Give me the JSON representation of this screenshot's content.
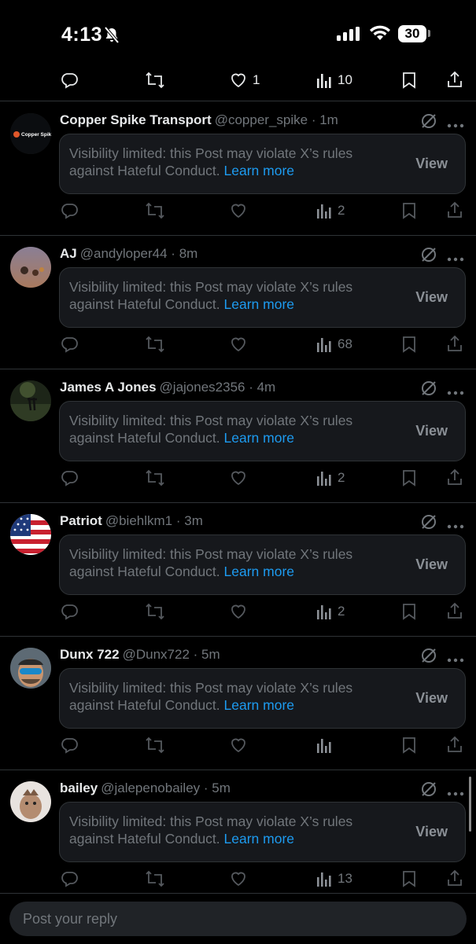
{
  "status": {
    "time": "4:13",
    "battery": "30"
  },
  "top_actions": {
    "likes": "1",
    "views": "10"
  },
  "posts": [
    {
      "name": "Copper Spike Transport",
      "handle": "@copper_spike",
      "time": "1m",
      "avatar_logo_text": "Copper Spike",
      "notice": "Visibility limited: this Post may violate X’s rules against Hateful Conduct.",
      "learn_more": "Learn more",
      "view": "View",
      "views": "2"
    },
    {
      "name": "AJ",
      "handle": "@andyloper44",
      "time": "8m",
      "notice": "Visibility limited: this Post may violate X’s rules against Hateful Conduct.",
      "learn_more": "Learn more",
      "view": "View",
      "views": "68"
    },
    {
      "name": "James A Jones",
      "handle": "@jajones2356",
      "time": "4m",
      "notice": "Visibility limited: this Post may violate X’s rules against Hateful Conduct.",
      "learn_more": "Learn more",
      "view": "View",
      "views": "2"
    },
    {
      "name": "Patriot",
      "handle": "@biehlkm1",
      "time": "3m",
      "notice": "Visibility limited: this Post may violate X’s rules against Hateful Conduct.",
      "learn_more": "Learn more",
      "view": "View",
      "views": "2"
    },
    {
      "name": "Dunx 722",
      "handle": "@Dunx722",
      "time": "5m",
      "notice": "Visibility limited: this Post may violate X’s rules against Hateful Conduct.",
      "learn_more": "Learn more",
      "view": "View",
      "views": ""
    },
    {
      "name": "bailey",
      "handle": "@jalepenobailey",
      "time": "5m",
      "notice": "Visibility limited: this Post may violate X’s rules against Hateful Conduct.",
      "learn_more": "Learn more",
      "view": "View",
      "views": "13"
    }
  ],
  "reply": {
    "placeholder": "Post your reply"
  }
}
